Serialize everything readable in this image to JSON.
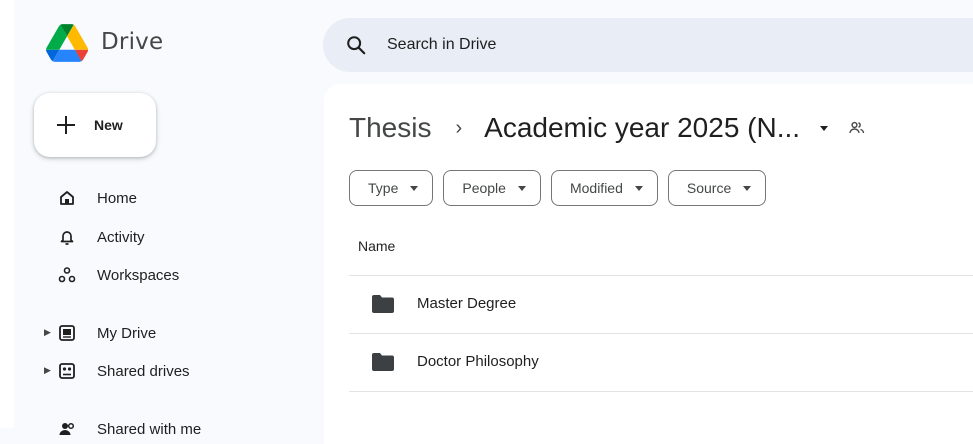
{
  "app": {
    "name": "Drive"
  },
  "search": {
    "placeholder": "Search in Drive"
  },
  "new_button": {
    "label": "New"
  },
  "sidebar": {
    "items": [
      {
        "label": "Home",
        "icon": "home-icon",
        "expandable": false
      },
      {
        "label": "Activity",
        "icon": "bell-icon",
        "expandable": false
      },
      {
        "label": "Workspaces",
        "icon": "workspaces-icon",
        "expandable": false
      },
      {
        "label": "My Drive",
        "icon": "my-drive-icon",
        "expandable": true
      },
      {
        "label": "Shared drives",
        "icon": "shared-drives-icon",
        "expandable": true
      },
      {
        "label": "Shared with me",
        "icon": "people-icon",
        "expandable": false
      }
    ]
  },
  "breadcrumb": {
    "parent": "Thesis",
    "separator": "›",
    "current": "Academic year 2025 (N..."
  },
  "filters": [
    {
      "label": "Type"
    },
    {
      "label": "People"
    },
    {
      "label": "Modified"
    },
    {
      "label": "Source"
    }
  ],
  "table": {
    "column_name": "Name",
    "rows": [
      {
        "name": "Master Degree",
        "type": "folder"
      },
      {
        "name": "Doctor Philosophy",
        "type": "folder"
      }
    ]
  },
  "colors": {
    "page_bg": "#f8fafd",
    "search_bg": "#e9eef6",
    "text": "#1f1f1f",
    "icon": "#444746"
  }
}
